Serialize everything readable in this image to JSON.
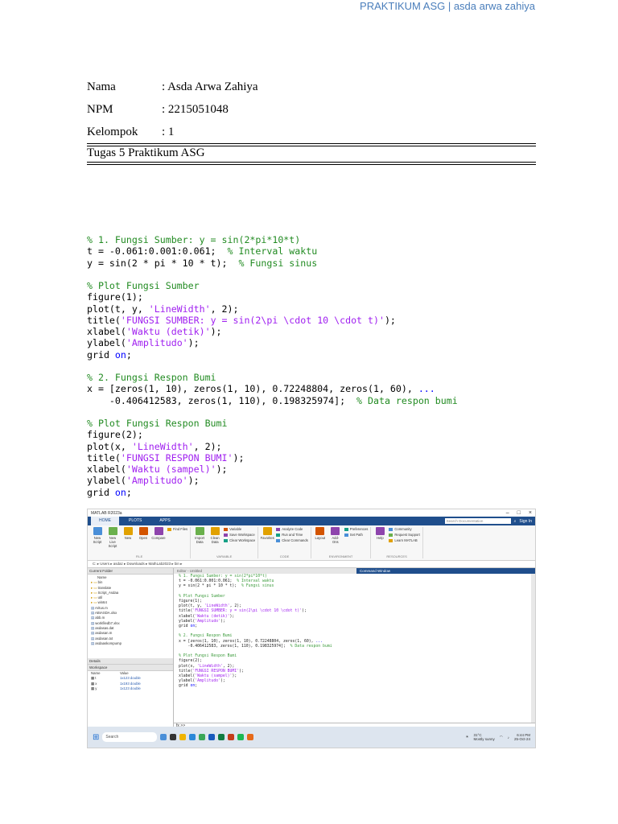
{
  "header": {
    "text": "PRAKTIKUM ASG | asda arwa zahiya"
  },
  "identity": [
    {
      "label": "Nama",
      "value": ": Asda Arwa Zahiya"
    },
    {
      "label": "NPM",
      "value": ": 2215051048"
    },
    {
      "label": "Kelompok",
      "value": ": 1"
    }
  ],
  "task_title": "Tugas 5 Praktikum ASG",
  "code_lines": [
    "% 1. Fungsi Sumber: y = sin(2*pi*10*t)",
    "t = -0.061:0.001:0.061;  % Interval waktu",
    "y = sin(2 * pi * 10 * t);  % Fungsi sinus",
    "",
    "% Plot Fungsi Sumber",
    "figure(1);",
    "plot(t, y, 'LineWidth', 2);",
    "title('FUNGSI SUMBER: y = sin(2\\pi \\cdot 10 \\cdot t)');",
    "xlabel('Waktu (detik)');",
    "ylabel('Amplitudo');",
    "grid on;",
    "",
    "% 2. Fungsi Respon Bumi",
    "x = [zeros(1, 10), zeros(1, 10), 0.72248804, zeros(1, 60), ...",
    "    -0.406412583, zeros(1, 110), 0.198325974];  % Data respon bumi",
    "",
    "% Plot Fungsi Respon Bumi",
    "figure(2);",
    "plot(x, 'LineWidth', 2);",
    "title('FUNGSI RESPON BUMI');",
    "xlabel('Waktu (sampel)');",
    "ylabel('Amplitudo');",
    "grid on;"
  ],
  "screenshot": {
    "window_title": "MATLAB R2023a",
    "tabs": [
      "HOME",
      "PLOTS",
      "APPS"
    ],
    "search_placeholder": "Search Documentation",
    "sign_in": "Sign In",
    "groups": [
      {
        "label": "FILE",
        "buttons": [
          "New Script",
          "New Live Script",
          "New",
          "Open",
          "Compare"
        ],
        "small": [
          "Find Files"
        ]
      },
      {
        "label": "VARIABLE",
        "buttons": [
          "Import Data",
          "Clean Data"
        ],
        "small": [
          "Variable",
          "Save Workspace",
          "Clear Workspace"
        ]
      },
      {
        "label": "CODE",
        "buttons": [
          "Favorites"
        ],
        "small": [
          "Analyze Code",
          "Run and Time",
          "Clear Commands"
        ]
      },
      {
        "label": "ENVIRONMENT",
        "buttons": [
          "Layout",
          "Add-Ons"
        ],
        "small": [
          "Preferences",
          "Set Path"
        ]
      },
      {
        "label": "RESOURCES",
        "buttons": [
          "Help"
        ],
        "small": [
          "Community",
          "Request Support",
          "Learn MATLAB"
        ]
      }
    ],
    "path": "C: ▸ Users ▸ asdaz ▸ Downloads ▸ MathLab2023 ▸ bin ▸",
    "current_folder": "Current Folder",
    "files_header": "Name",
    "files": [
      "bin",
      "translate",
      "Script_Asdaa",
      "util",
      "win64",
      "Aritus.m",
      "ABIASDA.xlsx",
      "abb.m",
      "workfiledb7.xlsx",
      "asdasas.dat",
      "asdasan.m",
      "asdasan.txt",
      "asdaaskompump"
    ],
    "details": "Details",
    "workspace": "Workspace",
    "ws_headers": [
      "Name",
      "Value"
    ],
    "ws_rows": [
      {
        "name": "t",
        "value": "1x123 double"
      },
      {
        "name": "x",
        "value": "1x193 double"
      },
      {
        "name": "y",
        "value": "1x123 double"
      }
    ],
    "editor_tab": "Editor - Untitled",
    "command_window": "Command Window",
    "prompt": "fx >>",
    "taskbar_search": "Search",
    "weather": "31°C",
    "weather_desc": "Mostly sunny",
    "time": "6:44 PM",
    "date": "25-Oct-24"
  }
}
